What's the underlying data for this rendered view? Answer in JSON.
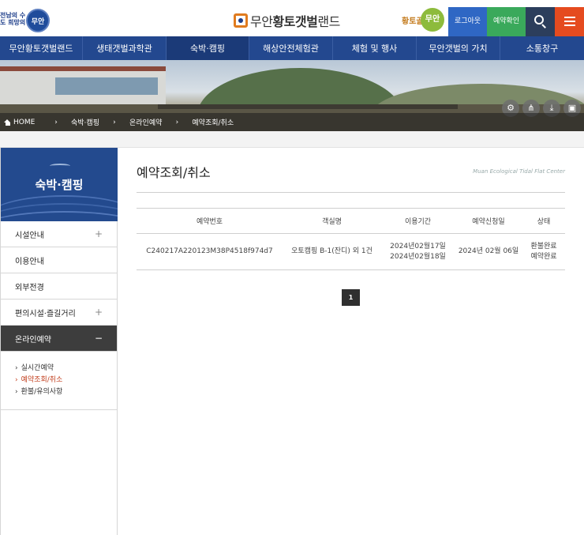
{
  "header": {
    "left_logo_text": "전남의 수도 희망의",
    "left_logo_seal": "무안",
    "brand_prefix": "무안",
    "brand_bold": "황토갯벌",
    "brand_suffix": "랜드",
    "right_logo_text": "황토골",
    "right_logo_seal": "무안",
    "logout_label": "로그아웃",
    "reserve_check_label": "예약확인"
  },
  "gnb": [
    {
      "label": "무안황토갯벌랜드"
    },
    {
      "label": "생태갯벌과학관"
    },
    {
      "label": "숙박·캠핑"
    },
    {
      "label": "해상안전체험관"
    },
    {
      "label": "체험 및 행사"
    },
    {
      "label": "무안갯벌의 가치"
    },
    {
      "label": "소통창구"
    }
  ],
  "breadcrumb": {
    "home": "HOME",
    "items": [
      "숙박·캠핑",
      "온라인예약",
      "예약조회/취소"
    ]
  },
  "sidebar": {
    "title": "숙박·캠핑",
    "items": [
      {
        "label": "시설안내",
        "toggle": "+"
      },
      {
        "label": "이용안내",
        "toggle": ""
      },
      {
        "label": "외부전경",
        "toggle": ""
      },
      {
        "label": "편의시설·즐길거리",
        "toggle": "+"
      },
      {
        "label": "온라인예약",
        "toggle": "−"
      }
    ],
    "sub_items": [
      {
        "label": "실시간예약"
      },
      {
        "label": "예약조회/취소"
      },
      {
        "label": "환불/유의사항"
      }
    ]
  },
  "main": {
    "title": "예약조회/취소",
    "subtitle": "Muan Ecological Tidal Flat Center",
    "columns": [
      "예약번호",
      "객실명",
      "이용기간",
      "예약신청일",
      "상태"
    ],
    "rows": [
      {
        "reservation_no": "C240217A220123M38P4518f974d7",
        "room": "오토캠핑 B-1(잔디) 외 1건",
        "period_start": "2024년02월17일",
        "period_end": "2024년02월18일",
        "applied_date": "2024년 02월 06일",
        "status_1": "환불완료",
        "status_2": "예약완료"
      }
    ],
    "current_page": "1"
  },
  "colors": {
    "gnb_bg": "#23488f",
    "logout_btn": "#2f67c4",
    "reserve_btn": "#3aa95b",
    "search_btn": "#2c3e5c",
    "menu_btn": "#e54b1f",
    "status_green": "#3aa55b"
  }
}
